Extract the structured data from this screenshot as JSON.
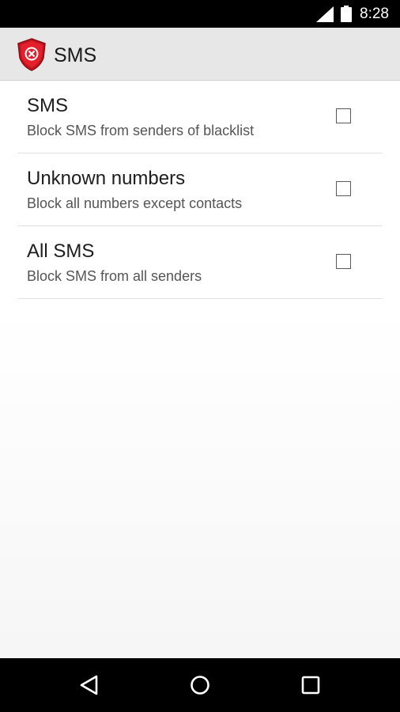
{
  "status_bar": {
    "time": "8:28",
    "icons": [
      "signal-icon",
      "battery-icon"
    ]
  },
  "action_bar": {
    "app_icon": "shield-block-icon",
    "title": "SMS",
    "brand_color": "#e3202b"
  },
  "preferences": [
    {
      "title": "SMS",
      "summary": "Block SMS from senders of blacklist",
      "checked": false
    },
    {
      "title": "Unknown numbers",
      "summary": "Block all numbers except contacts",
      "checked": false
    },
    {
      "title": "All SMS",
      "summary": "Block SMS from all senders",
      "checked": false
    }
  ],
  "nav_bar": {
    "icons": [
      "back-icon",
      "home-icon",
      "recents-icon"
    ]
  }
}
